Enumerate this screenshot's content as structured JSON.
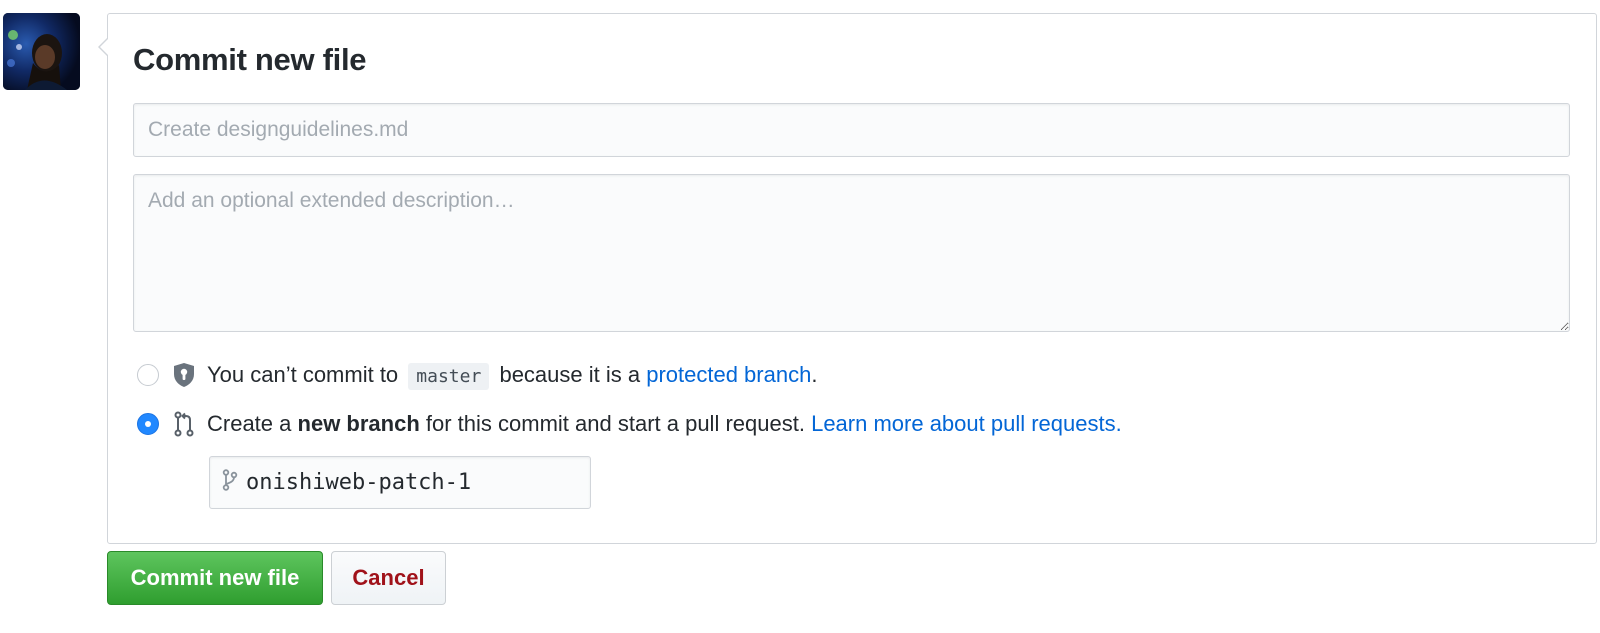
{
  "avatar": {
    "alt": "user avatar"
  },
  "form": {
    "title": "Commit new file",
    "summary_placeholder": "Create designguidelines.md",
    "summary_value": "",
    "description_placeholder": "Add an optional extended description…",
    "description_value": ""
  },
  "options": {
    "direct": {
      "selected": false,
      "icon": "shield-lock-icon",
      "text_before": "You can’t commit to",
      "branch_code": "master",
      "text_middle": "because it is a",
      "link_text": "protected branch",
      "text_after": "."
    },
    "new_branch": {
      "selected": true,
      "icon": "pull-request-icon",
      "text_before": "Create a",
      "bold_text": "new branch",
      "text_middle": "for this commit and start a pull request.",
      "link_text": "Learn more about pull requests."
    }
  },
  "branch_name": {
    "icon": "branch-icon",
    "value": "onishiweb-patch-1"
  },
  "buttons": {
    "commit_label": "Commit new file",
    "cancel_label": "Cancel"
  },
  "colors": {
    "accent_link": "#0366d6",
    "commit_green": "#2f9e2f",
    "cancel_red": "#a0121a",
    "radio_blue": "#2188ff"
  }
}
